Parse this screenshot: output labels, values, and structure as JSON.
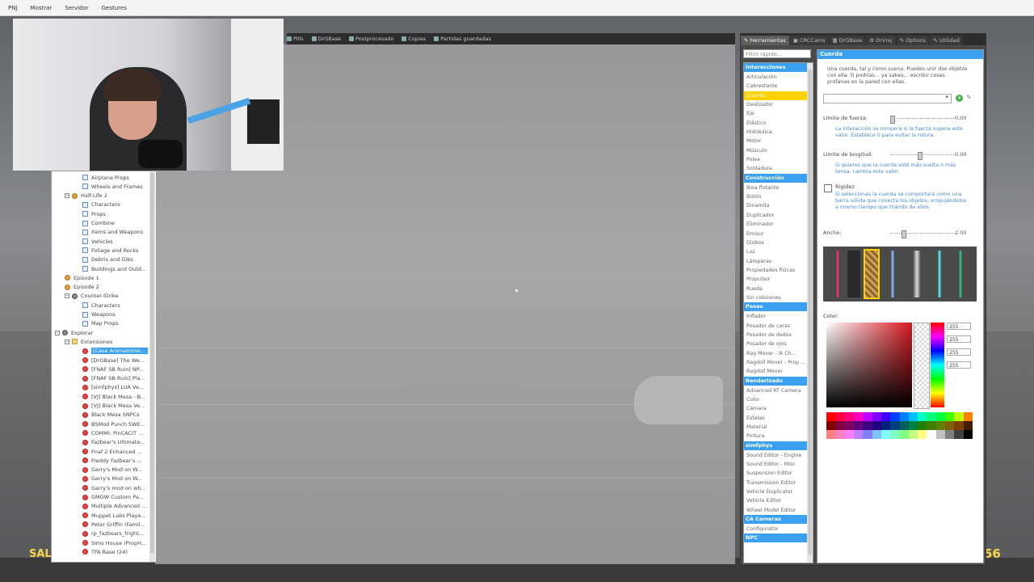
{
  "menubar": {
    "items": [
      "PNJ",
      "Mostrar",
      "Servidor",
      "Gestures"
    ]
  },
  "top_strip": {
    "tabs": [
      "Pills",
      "DrGBase",
      "Postprocesado",
      "Copias",
      "Partidas guardadas"
    ]
  },
  "spawn_tree": {
    "rows": [
      {
        "label": "Airplane Props",
        "icon": "page",
        "indent": 2
      },
      {
        "label": "Wheels and Frames",
        "icon": "page",
        "indent": 2
      },
      {
        "label": "Half-Life 2",
        "icon": "game",
        "indent": 1,
        "expander": "−"
      },
      {
        "label": "Characters",
        "icon": "page",
        "indent": 2
      },
      {
        "label": "Props",
        "icon": "page",
        "indent": 2
      },
      {
        "label": "Combine",
        "icon": "page",
        "indent": 2
      },
      {
        "label": "Items and Weapons",
        "icon": "page",
        "indent": 2
      },
      {
        "label": "Vehicles",
        "icon": "page",
        "indent": 2
      },
      {
        "label": "Foliage and Rocks",
        "icon": "page",
        "indent": 2
      },
      {
        "label": "Debris and Gibs",
        "icon": "page",
        "indent": 2
      },
      {
        "label": "Buildings and Outd...",
        "icon": "page",
        "indent": 2
      },
      {
        "label": "Episode 1",
        "icon": "game",
        "indent": 1
      },
      {
        "label": "Episode 2",
        "icon": "game",
        "indent": 1
      },
      {
        "label": "Counter-Strike",
        "icon": "cs",
        "indent": 1,
        "expander": "−"
      },
      {
        "label": "Characters",
        "icon": "page",
        "indent": 2
      },
      {
        "label": "Weapons",
        "icon": "page",
        "indent": 2
      },
      {
        "label": "Map Props",
        "icon": "page",
        "indent": 2
      },
      {
        "label": "Explorar",
        "icon": "cs",
        "indent": 0,
        "expander": "−"
      },
      {
        "label": "Extensiones",
        "icon": "folder",
        "indent": 1,
        "expander": "−"
      },
      {
        "label": "[Case Animatronic...",
        "icon": "addon",
        "indent": 2,
        "selected": true
      },
      {
        "label": "[DrGBase] The We...",
        "icon": "addon",
        "indent": 2
      },
      {
        "label": "[FNAF SB Ruin] NP...",
        "icon": "addon",
        "indent": 2
      },
      {
        "label": "[FNAF SB Ruin] Pla...",
        "icon": "addon",
        "indent": 2
      },
      {
        "label": "[simfphys] LUA Ve...",
        "icon": "addon",
        "indent": 2
      },
      {
        "label": "[VJ] Black Mesa - B...",
        "icon": "addon",
        "indent": 2
      },
      {
        "label": "[VJ] Black Mesa Ve...",
        "icon": "addon",
        "indent": 2
      },
      {
        "label": "Black Mesa SNPCs",
        "icon": "addon",
        "indent": 2
      },
      {
        "label": "BSMod Punch SWE...",
        "icon": "addon",
        "indent": 2
      },
      {
        "label": "COMMI: PinCACIT ...",
        "icon": "addon",
        "indent": 2
      },
      {
        "label": "Fazbear's Ultimate...",
        "icon": "addon",
        "indent": 2
      },
      {
        "label": "Fnaf 2 Enhanced ...",
        "icon": "addon",
        "indent": 2
      },
      {
        "label": "Freddy Fazbear's ...",
        "icon": "addon",
        "indent": 2
      },
      {
        "label": "Garry's Mod on W...",
        "icon": "addon",
        "indent": 2
      },
      {
        "label": "Garry's Mod on W...",
        "icon": "addon",
        "indent": 2
      },
      {
        "label": "Garry's mod on wh...",
        "icon": "addon",
        "indent": 2
      },
      {
        "label": "GMOW Custom Pa...",
        "icon": "addon",
        "indent": 2
      },
      {
        "label": "Multiple Advanced ...",
        "icon": "addon",
        "indent": 2
      },
      {
        "label": "Muppet Labs Playe...",
        "icon": "addon",
        "indent": 2
      },
      {
        "label": "Peter Griffin (Famil...",
        "icon": "addon",
        "indent": 2
      },
      {
        "label": "rp_fazbears_fright...",
        "icon": "addon",
        "indent": 2
      },
      {
        "label": "Sims House (PropH...",
        "icon": "addon",
        "indent": 2
      },
      {
        "label": "TFA Base (24)",
        "icon": "addon",
        "indent": 2
      }
    ]
  },
  "tool_panel": {
    "tabs": [
      "Herramientas",
      "CRCCams",
      "DrGBase",
      "DrVrej",
      "Options",
      "Utilidad"
    ],
    "search_placeholder": "Filtro rápido...",
    "list": [
      {
        "type": "cat",
        "label": "Interacciones"
      },
      {
        "type": "it",
        "label": "Articulación"
      },
      {
        "type": "it",
        "label": "Cabrestante"
      },
      {
        "type": "it",
        "label": "Cuerda",
        "selected": true
      },
      {
        "type": "it",
        "label": "Deslizador"
      },
      {
        "type": "it",
        "label": "Eje"
      },
      {
        "type": "it",
        "label": "Elástico"
      },
      {
        "type": "it",
        "label": "Hidráulica"
      },
      {
        "type": "it",
        "label": "Motor"
      },
      {
        "type": "it",
        "label": "Músculo"
      },
      {
        "type": "it",
        "label": "Polea"
      },
      {
        "type": "it",
        "label": "Soldadura"
      },
      {
        "type": "cat",
        "label": "Construcción"
      },
      {
        "type": "it",
        "label": "Boia flotante"
      },
      {
        "type": "it",
        "label": "Botón"
      },
      {
        "type": "it",
        "label": "Dinamita"
      },
      {
        "type": "it",
        "label": "Duplicador"
      },
      {
        "type": "it",
        "label": "Eliminador"
      },
      {
        "type": "it",
        "label": "Emisor"
      },
      {
        "type": "it",
        "label": "Globos"
      },
      {
        "type": "it",
        "label": "Luz"
      },
      {
        "type": "it",
        "label": "Lámparas"
      },
      {
        "type": "it",
        "label": "Propiedades físicas"
      },
      {
        "type": "it",
        "label": "Propulsor"
      },
      {
        "type": "it",
        "label": "Rueda"
      },
      {
        "type": "it",
        "label": "Sin colisiones"
      },
      {
        "type": "cat",
        "label": "Poses"
      },
      {
        "type": "it",
        "label": "Inflador"
      },
      {
        "type": "it",
        "label": "Posador de caras"
      },
      {
        "type": "it",
        "label": "Posador de dedos"
      },
      {
        "type": "it",
        "label": "Posador de ojos"
      },
      {
        "type": "it",
        "label": "Rag Mover - Ik Ch..."
      },
      {
        "type": "it",
        "label": "Ragdoll Mover - Prop ..."
      },
      {
        "type": "it",
        "label": "Ragdoll Mover"
      },
      {
        "type": "cat",
        "label": "Renderizado"
      },
      {
        "type": "it",
        "label": "Advanced RT Camera"
      },
      {
        "type": "it",
        "label": "Color"
      },
      {
        "type": "it",
        "label": "Cámara"
      },
      {
        "type": "it",
        "label": "Estelas"
      },
      {
        "type": "it",
        "label": "Material"
      },
      {
        "type": "it",
        "label": "Pintura"
      },
      {
        "type": "cat",
        "label": "simfphys"
      },
      {
        "type": "it",
        "label": "Sound Editor - Engine"
      },
      {
        "type": "it",
        "label": "Sound Editor - Misc"
      },
      {
        "type": "it",
        "label": "Suspension Editor"
      },
      {
        "type": "it",
        "label": "Transmission Editor"
      },
      {
        "type": "it",
        "label": "Vehicle Duplicator"
      },
      {
        "type": "it",
        "label": "Vehicle Editor"
      },
      {
        "type": "it",
        "label": "Wheel Model Editor"
      },
      {
        "type": "cat",
        "label": "CA Cameras"
      },
      {
        "type": "it",
        "label": "Configurator"
      },
      {
        "type": "cat",
        "label": "NPC"
      }
    ],
    "props": {
      "title": "Cuerda",
      "description": "Una cuerda, tal y como suena. Puedes unir dos objetos con ella. O podrías... ya sabes... escribir cosas profanas en la pared con ellas.",
      "force_label": "Límite de fuerza:",
      "force_value": "0.00",
      "force_hint": "La interacción se romperá si la fuerza supera este valor. Establece 0 para evitar la rotura.",
      "length_label": "Límite de longitud:",
      "length_value": "0.00",
      "length_hint": "Si quieres que la cuerda esté más suelta o más tensa, cambia este valor.",
      "rigid_label": "Rigidez",
      "rigid_hint": "Si seleccionas la cuerda se comportará como una barra sólida que conecta los objetos, empujándolos a mismo tiempo que tirándo de ellos.",
      "width_label": "Ancho:",
      "width_value": "2.00",
      "color_label": "Color:",
      "rgba": [
        "255",
        "255",
        "255",
        "255"
      ]
    }
  },
  "hud": {
    "left": "SAL",
    "right": "56"
  },
  "colors": {
    "accent": "#3aa1f2",
    "selected_tool": "#fdd200",
    "hud": "#f7d64a"
  }
}
